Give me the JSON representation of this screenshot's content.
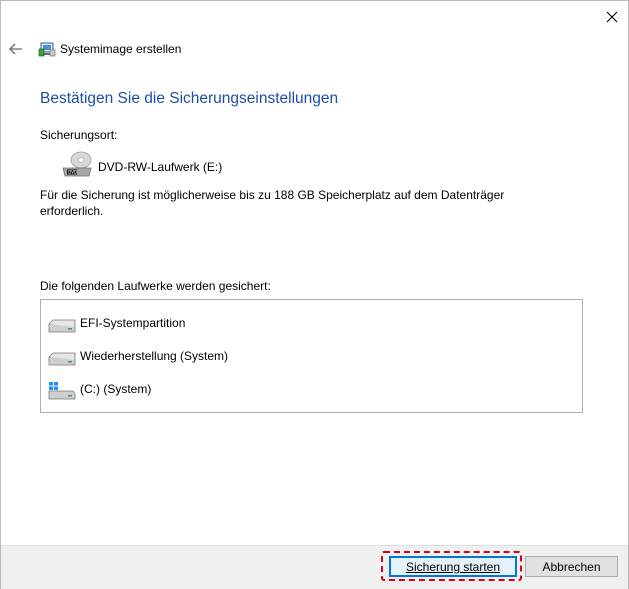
{
  "window": {
    "title": "Systemimage erstellen",
    "close_icon": "close-icon"
  },
  "main": {
    "heading": "Bestätigen Sie die Sicherungseinstellungen",
    "location_label": "Sicherungsort:",
    "location_drive": "DVD-RW-Laufwerk (E:)",
    "info_text": "Für die Sicherung ist möglicherweise bis zu 188 GB Speicherplatz auf dem Datenträger erforderlich.",
    "drives_label": "Die folgenden Laufwerke werden gesichert:",
    "drives": [
      {
        "label": "EFI-Systempartition",
        "icon": "hard-drive-icon"
      },
      {
        "label": "Wiederherstellung (System)",
        "icon": "hard-drive-icon"
      },
      {
        "label": "(C:) (System)",
        "icon": "windows-drive-icon"
      }
    ]
  },
  "footer": {
    "start_label": "Sicherung starten",
    "cancel_label": "Abbrechen"
  },
  "colors": {
    "heading": "#1e4fa6",
    "highlight": "#d9001b",
    "focus": "#0078d7"
  }
}
